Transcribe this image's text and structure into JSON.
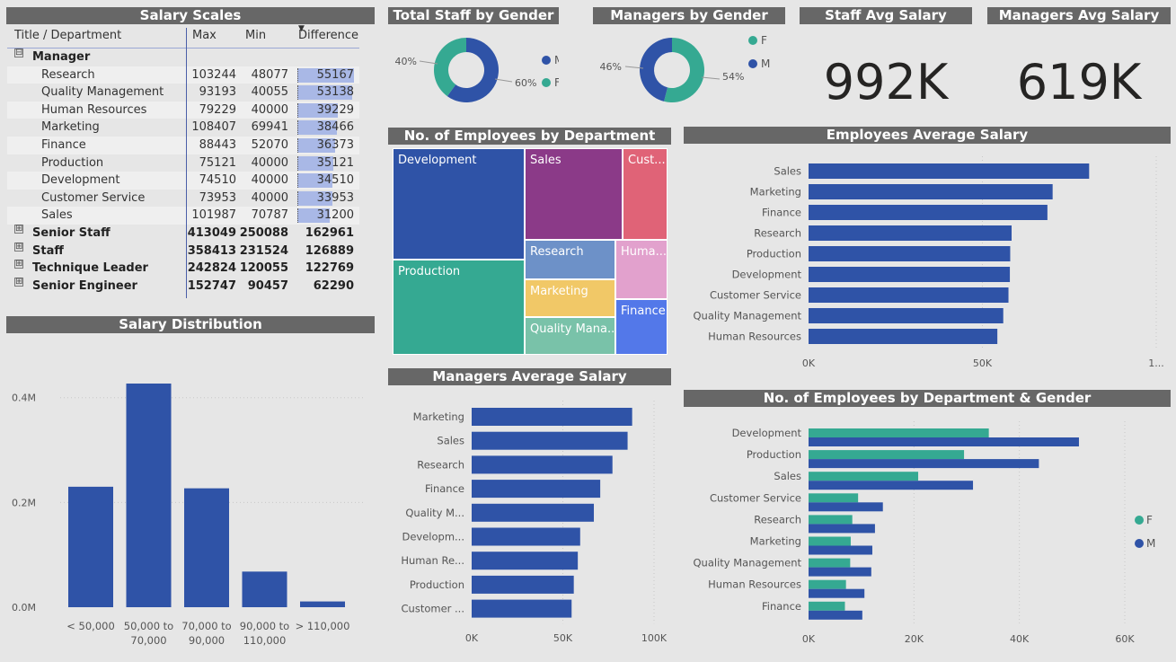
{
  "colors": {
    "blue": "#2f53a7",
    "teal": "#35a992",
    "title_bg": "#676767"
  },
  "salary_scales": {
    "title": "Salary Scales",
    "headers": {
      "name": "Title / Department",
      "max": "Max",
      "min": "Min",
      "diff": "Difference"
    },
    "manager": {
      "label": "Manager",
      "expander": "⊟"
    },
    "manager_children": [
      {
        "name": "Research",
        "max": "103244",
        "min": "48077",
        "diff": "55167",
        "diff_value": 55167
      },
      {
        "name": "Quality Management",
        "max": "93193",
        "min": "40055",
        "diff": "53138",
        "diff_value": 53138
      },
      {
        "name": "Human Resources",
        "max": "79229",
        "min": "40000",
        "diff": "39229",
        "diff_value": 39229
      },
      {
        "name": "Marketing",
        "max": "108407",
        "min": "69941",
        "diff": "38466",
        "diff_value": 38466
      },
      {
        "name": "Finance",
        "max": "88443",
        "min": "52070",
        "diff": "36373",
        "diff_value": 36373
      },
      {
        "name": "Production",
        "max": "75121",
        "min": "40000",
        "diff": "35121",
        "diff_value": 35121
      },
      {
        "name": "Development",
        "max": "74510",
        "min": "40000",
        "diff": "34510",
        "diff_value": 34510
      },
      {
        "name": "Customer Service",
        "max": "73953",
        "min": "40000",
        "diff": "33953",
        "diff_value": 33953
      },
      {
        "name": "Sales",
        "max": "101987",
        "min": "70787",
        "diff": "31200",
        "diff_value": 31200
      }
    ],
    "groups": [
      {
        "name": "Senior Staff",
        "max": "413049",
        "min": "250088",
        "diff": "162961",
        "expander": "⊞"
      },
      {
        "name": "Staff",
        "max": "358413",
        "min": "231524",
        "diff": "126889",
        "expander": "⊞"
      },
      {
        "name": "Technique Leader",
        "max": "242824",
        "min": "120055",
        "diff": "122769",
        "expander": "⊞"
      },
      {
        "name": "Senior Engineer",
        "max": "152747",
        "min": "90457",
        "diff": "62290",
        "expander": "⊞"
      }
    ]
  },
  "kpis": {
    "staff_avg": {
      "title": "Staff Avg Salary",
      "value": "992K"
    },
    "managers_avg": {
      "title": "Managers Avg Salary",
      "value": "619K"
    }
  },
  "chart_data": [
    {
      "id": "total_staff_gender",
      "type": "pie",
      "title": "Total Staff by Gender",
      "slices": [
        {
          "label": "M",
          "value": 60,
          "text": "60%"
        },
        {
          "label": "F",
          "value": 40,
          "text": "40%"
        }
      ],
      "legend": [
        "M",
        "F"
      ]
    },
    {
      "id": "managers_gender",
      "type": "pie",
      "title": "Managers by Gender",
      "slices": [
        {
          "label": "M",
          "value": 46,
          "text": "46%"
        },
        {
          "label": "F",
          "value": 54,
          "text": "54%"
        }
      ],
      "legend": [
        "F",
        "M"
      ]
    },
    {
      "id": "employees_by_department",
      "type": "treemap",
      "title": "No. of Employees by Department",
      "items": [
        {
          "label": "Development",
          "color": "#2f53a7"
        },
        {
          "label": "Production",
          "color": "#35a992"
        },
        {
          "label": "Sales",
          "color": "#8b3a88"
        },
        {
          "label": "Cust...",
          "color": "#e06377"
        },
        {
          "label": "Research",
          "color": "#6d91c8"
        },
        {
          "label": "Huma...",
          "color": "#e2a1cd"
        },
        {
          "label": "Marketing",
          "color": "#f1c867"
        },
        {
          "label": "Quality Mana...",
          "color": "#79c2a9"
        },
        {
          "label": "Finance",
          "color": "#5378e9"
        }
      ]
    },
    {
      "id": "employees_avg_salary",
      "type": "bar",
      "orientation": "horizontal",
      "title": "Employees Average Salary",
      "categories": [
        "Sales",
        "Marketing",
        "Finance",
        "Research",
        "Production",
        "Development",
        "Customer Service",
        "Quality Management",
        "Human Resources"
      ],
      "values": [
        80700,
        70200,
        68700,
        58400,
        58000,
        57900,
        57500,
        56000,
        54300
      ],
      "xlim": [
        0,
        100000
      ],
      "xticks": [
        "0K",
        "50K",
        "1..."
      ]
    },
    {
      "id": "managers_avg_salary",
      "type": "bar",
      "orientation": "horizontal",
      "title": "Managers Average Salary",
      "categories": [
        "Marketing",
        "Sales",
        "Research",
        "Finance",
        "Quality M...",
        "Developm...",
        "Human Re...",
        "Production",
        "Customer ..."
      ],
      "values": [
        88000,
        85500,
        77200,
        70500,
        67000,
        59500,
        58200,
        56000,
        54800
      ],
      "xlim": [
        0,
        100000
      ],
      "xticks": [
        "0K",
        "50K",
        "100K"
      ]
    },
    {
      "id": "salary_distribution",
      "type": "bar",
      "title": "Salary Distribution",
      "categories": [
        "< 50,000",
        "50,000 to 70,000",
        "70,000 to 90,000",
        "90,000 to 110,000",
        "> 110,000"
      ],
      "category_lines": [
        [
          "< 50,000"
        ],
        [
          "50,000 to",
          "70,000"
        ],
        [
          "70,000 to",
          "90,000"
        ],
        [
          "90,000 to",
          "110,000"
        ],
        [
          "> 110,000"
        ]
      ],
      "values": [
        230000,
        427000,
        227000,
        68000,
        11000
      ],
      "ylim": [
        0,
        440000
      ],
      "yticks": [
        "0.0M",
        "0.2M",
        "0.4M"
      ]
    },
    {
      "id": "employees_by_dept_gender",
      "type": "bar",
      "orientation": "horizontal",
      "title": "No. of Employees by Department & Gender",
      "categories": [
        "Development",
        "Production",
        "Sales",
        "Customer Service",
        "Research",
        "Marketing",
        "Quality Management",
        "Human Resources",
        "Finance"
      ],
      "series": [
        {
          "name": "F",
          "values": [
            34200,
            29500,
            20800,
            9400,
            8300,
            8000,
            7900,
            7100,
            6900
          ]
        },
        {
          "name": "M",
          "values": [
            51300,
            43700,
            31200,
            14100,
            12600,
            12100,
            11900,
            10600,
            10200
          ]
        }
      ],
      "xlim": [
        0,
        60000
      ],
      "xticks": [
        "0K",
        "20K",
        "40K",
        "60K"
      ]
    }
  ]
}
